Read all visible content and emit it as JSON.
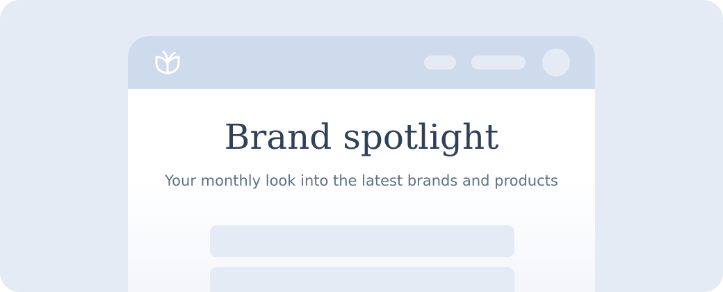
{
  "header": {
    "logo_icon": "leaf-sprout-icon",
    "accent_color": "#cedbec"
  },
  "hero": {
    "title": "Brand spotlight",
    "subtitle": "Your monthly look into the latest brands and products"
  },
  "colors": {
    "background": "#e5ebf4",
    "title": "#2f4159",
    "subtitle": "#5c6f87",
    "placeholder": "#e5ebf4"
  }
}
